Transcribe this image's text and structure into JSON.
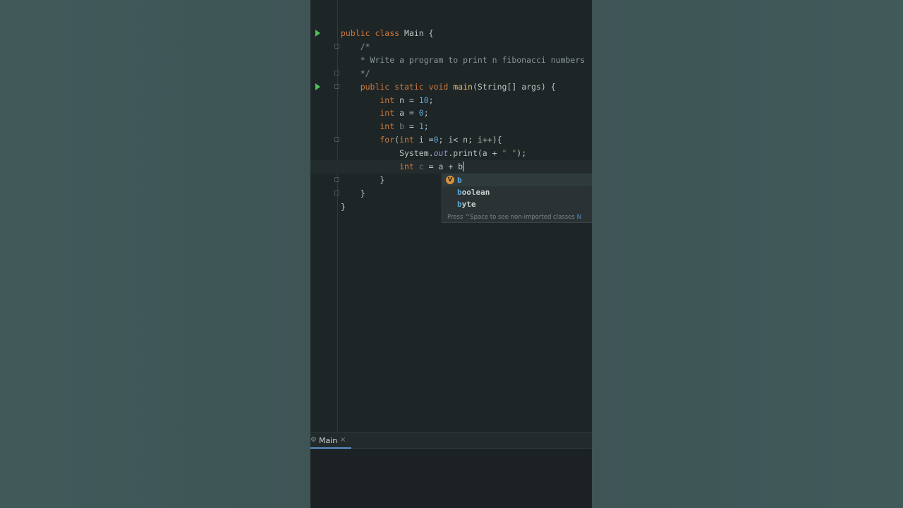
{
  "editor": {
    "lines": [
      {
        "tokens": [
          [
            "kw",
            "public class "
          ],
          [
            "",
            "Main {"
          ]
        ],
        "run": true,
        "fold": false
      },
      {
        "tokens": [
          [
            "cm",
            "    /*"
          ]
        ],
        "run": false,
        "fold": true
      },
      {
        "tokens": [
          [
            "cm",
            "    * Write a program to print n fibonacci numbers"
          ]
        ],
        "run": false,
        "fold": false
      },
      {
        "tokens": [
          [
            "cm",
            "    */"
          ]
        ],
        "run": false,
        "fold": true
      },
      {
        "tokens": [
          [
            "kw",
            "    public static void "
          ],
          [
            "fn",
            "main"
          ],
          [
            "",
            "(String[] args) {"
          ]
        ],
        "run": true,
        "fold": true
      },
      {
        "tokens": [
          [
            "kw",
            "        int "
          ],
          [
            "",
            "n = "
          ],
          [
            "num",
            "10"
          ],
          [
            "",
            ";"
          ]
        ],
        "run": false,
        "fold": false
      },
      {
        "tokens": [
          [
            "kw",
            "        int "
          ],
          [
            "",
            "a = "
          ],
          [
            "num",
            "0"
          ],
          [
            "",
            ";"
          ]
        ],
        "run": false,
        "fold": false
      },
      {
        "tokens": [
          [
            "kw",
            "        int "
          ],
          [
            "dim",
            "b"
          ],
          [
            "",
            " = "
          ],
          [
            "num",
            "1"
          ],
          [
            "",
            ";"
          ]
        ],
        "run": false,
        "fold": false
      },
      {
        "tokens": [
          [
            "kw",
            "        for"
          ],
          [
            "",
            "("
          ],
          [
            "kw",
            "int "
          ],
          [
            "",
            "i ="
          ],
          [
            "num",
            "0"
          ],
          [
            "",
            "; i< n; i++){"
          ]
        ],
        "run": false,
        "fold": true
      },
      {
        "tokens": [
          [
            "",
            "            System."
          ],
          [
            "it",
            "out"
          ],
          [
            "",
            ".print(a + "
          ],
          [
            "str",
            "\" \""
          ],
          [
            "",
            ");"
          ]
        ],
        "run": false,
        "fold": false
      },
      {
        "tokens": [
          [
            "kw",
            "            int "
          ],
          [
            "dim",
            "c"
          ],
          [
            "",
            " = a + b"
          ]
        ],
        "run": false,
        "fold": false,
        "current": true,
        "caret": true
      },
      {
        "tokens": [
          [
            "",
            "        }"
          ]
        ],
        "run": false,
        "fold": true
      },
      {
        "tokens": [
          [
            "",
            "    }"
          ]
        ],
        "run": false,
        "fold": true
      },
      {
        "tokens": [
          [
            "",
            "}"
          ]
        ],
        "run": false,
        "fold": false
      }
    ]
  },
  "completion": {
    "items": [
      {
        "match": "b",
        "rest": "",
        "icon": "V",
        "selected": true
      },
      {
        "match": "b",
        "rest": "oolean",
        "icon": "",
        "selected": false
      },
      {
        "match": "b",
        "rest": "yte",
        "icon": "",
        "selected": false
      }
    ],
    "hint": "Press ^Space to see non-imported classes",
    "hint_link": "N"
  },
  "run_panel": {
    "tab_label": "Main",
    "tab_icon": "run-config-icon",
    "close_glyph": "×"
  }
}
